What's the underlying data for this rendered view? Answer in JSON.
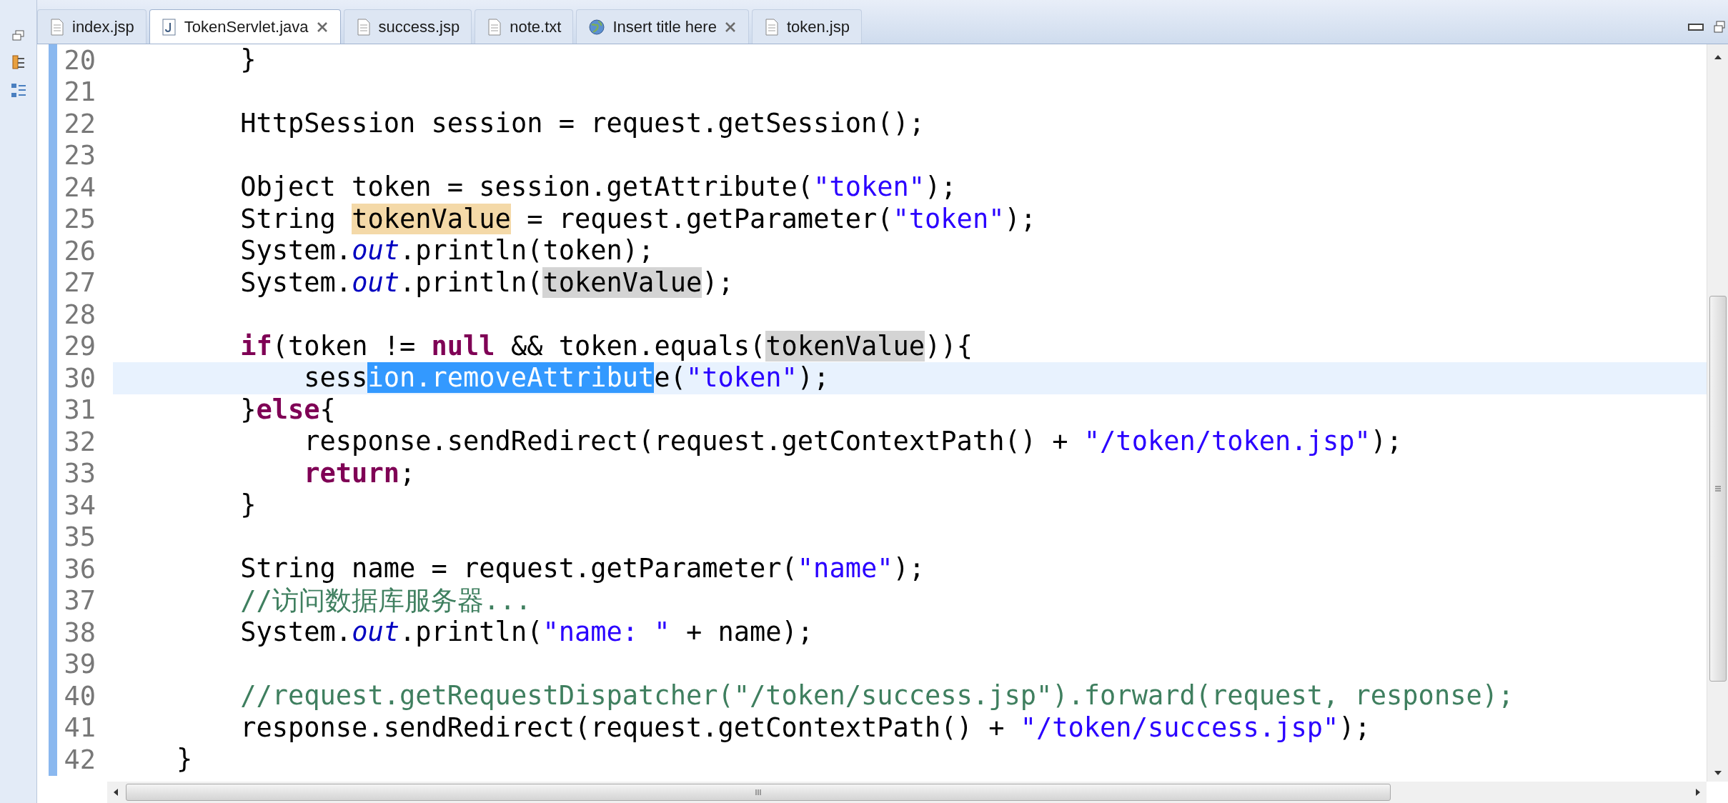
{
  "tabs": [
    {
      "label": "index.jsp",
      "kind": "file",
      "selected": false,
      "closable": false
    },
    {
      "label": "TokenServlet.java",
      "kind": "java",
      "selected": true,
      "closable": true
    },
    {
      "label": "success.jsp",
      "kind": "file",
      "selected": false,
      "closable": false
    },
    {
      "label": "note.txt",
      "kind": "file",
      "selected": false,
      "closable": false
    },
    {
      "label": "Insert title here",
      "kind": "browser",
      "selected": false,
      "closable": true
    },
    {
      "label": "token.jsp",
      "kind": "file",
      "selected": false,
      "closable": false
    }
  ],
  "editor": {
    "lines": [
      {
        "number": "20",
        "current": false,
        "segments": [
          {
            "text": "        }",
            "kind": "plain"
          }
        ]
      },
      {
        "number": "21",
        "current": false
      },
      {
        "number": "22",
        "current": false,
        "segments": [
          {
            "text": "        HttpSession session = request.getSession();",
            "kind": "plain"
          }
        ]
      },
      {
        "number": "23",
        "current": false
      },
      {
        "number": "24",
        "current": false,
        "segments": [
          {
            "text": "        Object token = session.getAttribute(",
            "kind": "plain"
          },
          {
            "text": "\"token\"",
            "kind": "string"
          },
          {
            "text": ");",
            "kind": "plain"
          }
        ]
      },
      {
        "number": "25",
        "current": false,
        "segments": [
          {
            "text": "        String ",
            "kind": "plain"
          },
          {
            "text": "tokenValue",
            "kind": "plain",
            "write_occurrence": true
          },
          {
            "text": " = request.getParameter(",
            "kind": "plain"
          },
          {
            "text": "\"token\"",
            "kind": "string"
          },
          {
            "text": ");",
            "kind": "plain"
          }
        ]
      },
      {
        "number": "26",
        "current": false,
        "segments": [
          {
            "text": "        System.",
            "kind": "plain"
          },
          {
            "text": "out",
            "kind": "field"
          },
          {
            "text": ".println(token);",
            "kind": "plain"
          }
        ]
      },
      {
        "number": "27",
        "current": false,
        "segments": [
          {
            "text": "        System.",
            "kind": "plain"
          },
          {
            "text": "out",
            "kind": "field"
          },
          {
            "text": ".println(",
            "kind": "plain"
          },
          {
            "text": "tokenValue",
            "kind": "plain",
            "read_occurrence": true
          },
          {
            "text": ");",
            "kind": "plain"
          }
        ]
      },
      {
        "number": "28",
        "current": false
      },
      {
        "number": "29",
        "current": false,
        "segments": [
          {
            "text": "        if",
            "kind": "keyword"
          },
          {
            "text": "(token != ",
            "kind": "plain"
          },
          {
            "text": "null",
            "kind": "keyword"
          },
          {
            "text": " && token.equals(",
            "kind": "plain"
          },
          {
            "text": "tokenValue",
            "kind": "plain",
            "read_occurrence": true
          },
          {
            "text": ")){",
            "kind": "plain"
          }
        ]
      },
      {
        "number": "30",
        "current": true,
        "segments": [
          {
            "text": "            sess",
            "kind": "plain"
          },
          {
            "text": "ion.removeAttribut",
            "kind": "plain",
            "selected": true
          },
          {
            "text": "e(",
            "kind": "plain"
          },
          {
            "text": "\"token\"",
            "kind": "string"
          },
          {
            "text": ");",
            "kind": "plain"
          }
        ]
      },
      {
        "number": "31",
        "current": false,
        "segments": [
          {
            "text": "        }",
            "kind": "plain"
          },
          {
            "text": "else",
            "kind": "keyword"
          },
          {
            "text": "{",
            "kind": "plain"
          }
        ]
      },
      {
        "number": "32",
        "current": false,
        "segments": [
          {
            "text": "            response.sendRedirect(request.getContextPath() + ",
            "kind": "plain"
          },
          {
            "text": "\"/token/token.jsp\"",
            "kind": "string"
          },
          {
            "text": ");",
            "kind": "plain"
          }
        ]
      },
      {
        "number": "33",
        "current": false,
        "segments": [
          {
            "text": "            return",
            "kind": "keyword"
          },
          {
            "text": ";",
            "kind": "plain"
          }
        ]
      },
      {
        "number": "34",
        "current": false,
        "segments": [
          {
            "text": "        }",
            "kind": "plain"
          }
        ]
      },
      {
        "number": "35",
        "current": false
      },
      {
        "number": "36",
        "current": false,
        "segments": [
          {
            "text": "        String name = request.getParameter(",
            "kind": "plain"
          },
          {
            "text": "\"name\"",
            "kind": "string"
          },
          {
            "text": ");",
            "kind": "plain"
          }
        ]
      },
      {
        "number": "37",
        "current": false,
        "segments": [
          {
            "text": "        //访问数据库服务器...",
            "kind": "comment"
          }
        ]
      },
      {
        "number": "38",
        "current": false,
        "segments": [
          {
            "text": "        System.",
            "kind": "plain"
          },
          {
            "text": "out",
            "kind": "field"
          },
          {
            "text": ".println(",
            "kind": "plain"
          },
          {
            "text": "\"name: \"",
            "kind": "string"
          },
          {
            "text": " + name);",
            "kind": "plain"
          }
        ]
      },
      {
        "number": "39",
        "current": false
      },
      {
        "number": "40",
        "current": false,
        "segments": [
          {
            "text": "        //request.getRequestDispatcher(\"/token/success.jsp\").forward(request, response);",
            "kind": "comment"
          }
        ]
      },
      {
        "number": "41",
        "current": false,
        "segments": [
          {
            "text": "        response.sendRedirect(request.getContextPath() + ",
            "kind": "plain"
          },
          {
            "text": "\"/token/success.jsp\"",
            "kind": "string"
          },
          {
            "text": ");",
            "kind": "plain"
          }
        ]
      },
      {
        "number": "42",
        "current": false,
        "segments": [
          {
            "text": "    }",
            "kind": "plain"
          }
        ]
      }
    ]
  }
}
